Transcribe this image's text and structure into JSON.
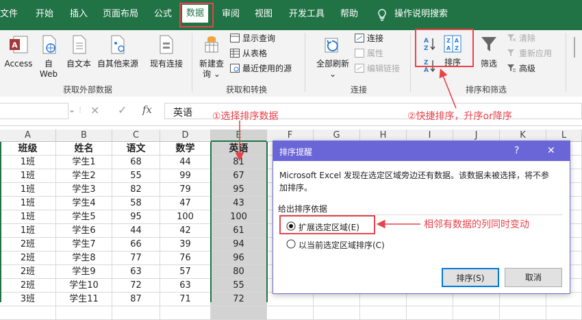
{
  "tabs": [
    "文件",
    "开始",
    "插入",
    "页面布局",
    "公式",
    "数据",
    "审阅",
    "视图",
    "开发工具",
    "帮助",
    "操作说明搜索"
  ],
  "ribbon": {
    "access": "Access",
    "web_line1": "自",
    "web_line2": "Web",
    "text": "自文本",
    "other": "自其他来源",
    "existing": "现有连接",
    "newquery_line1": "新建查",
    "newquery_line2": "询",
    "show_query": "显示查询",
    "from_table": "从表格",
    "recent_sources": "最近使用的源",
    "refresh_all": "全部刷新",
    "connections": "连接",
    "properties": "属性",
    "edit_links": "编辑链接",
    "sort": "排序",
    "filter": "筛选",
    "clear": "清除",
    "reapply": "重新应用",
    "advanced": "高级",
    "az_top": "A",
    "az_bottom": "Z",
    "za_top": "Z",
    "za_bottom": "A",
    "groups": [
      "获取外部数据",
      "获取和转换",
      "连接",
      "排序和筛选"
    ]
  },
  "formula": {
    "cancel_symbol": "×",
    "confirm_symbol": "✓",
    "fx": "fx",
    "content": "英语"
  },
  "columns": [
    "A",
    "B",
    "C",
    "D",
    "E",
    "F",
    "G",
    "H",
    "I",
    "J",
    "K",
    "L"
  ],
  "headers": [
    "班级",
    "姓名",
    "语文",
    "数学",
    "英语"
  ],
  "rows": [
    [
      "1班",
      "学生1",
      "68",
      "44",
      "81"
    ],
    [
      "1班",
      "学生2",
      "55",
      "99",
      "67"
    ],
    [
      "1班",
      "学生3",
      "82",
      "79",
      "95"
    ],
    [
      "1班",
      "学生4",
      "58",
      "47",
      "43"
    ],
    [
      "1班",
      "学生5",
      "95",
      "100",
      "100"
    ],
    [
      "1班",
      "学生6",
      "44",
      "42",
      "61"
    ],
    [
      "2班",
      "学生7",
      "66",
      "39",
      "94"
    ],
    [
      "2班",
      "学生8",
      "77",
      "76",
      "96"
    ],
    [
      "2班",
      "学生9",
      "63",
      "57",
      "80"
    ],
    [
      "2班",
      "学生10",
      "72",
      "63",
      "55"
    ],
    [
      "3班",
      "学生11",
      "87",
      "71",
      "72"
    ]
  ],
  "dialog": {
    "title": "排序提醒",
    "help": "?",
    "close": "✕",
    "message_line1": "Microsoft Excel 发现在选定区域旁边还有数据。该数据未被选择，将不参",
    "message_line2": "加排序。",
    "group_label": "给出排序依据",
    "option_expand": "扩展选定区域(E)",
    "option_current": "以当前选定区域排序(C)",
    "sort_button": "排序(S)",
    "cancel_button": "取消"
  },
  "annotations": {
    "step1": "①选择排序数据",
    "step2": "②快捷排序，升序or降序",
    "adjacent": "相邻有数据的列同时变动"
  },
  "colors": {
    "excel_green": "#217346",
    "dialog_purple": "#6b66d8",
    "annotation_red": "#e8424a"
  }
}
